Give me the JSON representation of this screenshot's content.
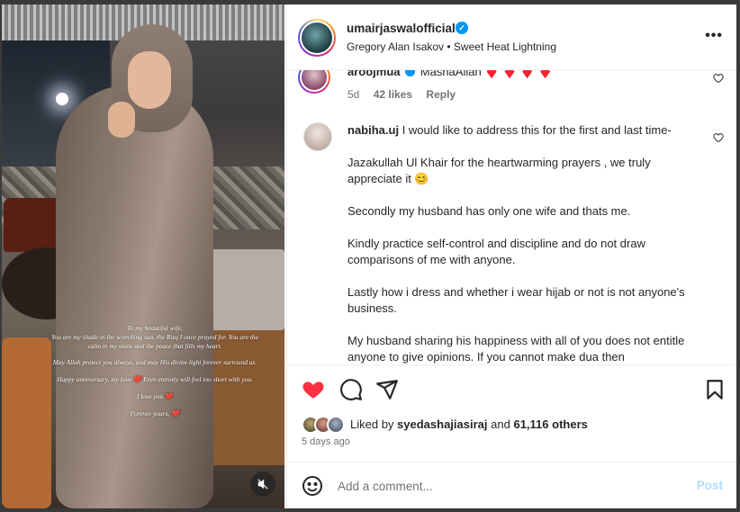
{
  "post": {
    "username": "umairjaswalofficial",
    "verified": true,
    "audio": "Gregory Alan Isakov • Sweet Heat Lightning",
    "date": "5 days ago"
  },
  "media": {
    "overlay_lines": [
      "To my beautiful wife,",
      "You are my shade in the scorching sun, the Rizq I once prayed for. You are the calm in my smile and the peace that fills my heart.",
      "May Allah protect you always, and may His divine light forever surround us.",
      "Happy anniversary, my love ❤️ Even eternity will feel too short with you.",
      "I love you ❤️",
      "Forever yours, ❤️"
    ]
  },
  "comments": [
    {
      "username": "aroojmua",
      "text": "MashaAllah ♦️ ♦️ ♦️ ♦️",
      "age": "5d",
      "likes": "42 likes",
      "reply": "Reply"
    },
    {
      "username": "nabiha.uj",
      "text": "I would like to address this for the first and last time-\n\nJazakullah Ul Khair for the heartwarming prayers , we truly appreciate it 😊\n\nSecondly my husband has only one wife and thats me.\n\nKindly practice self-control and discipline and do not draw comparisons of me with anyone.\n\nLastly how i dress and whether i wear hijab or not is not anyone's business.\n\nMy husband sharing his happiness with all of you does not entitle anyone to give opinions. If you cannot make dua then"
    }
  ],
  "likes": {
    "prefix": "Liked by",
    "user": "syedashajiasiraj",
    "and": "and",
    "count": "61,116 others"
  },
  "composer": {
    "placeholder": "Add a comment...",
    "post_label": "Post"
  },
  "colors": {
    "like_red": "#ff3040",
    "verified_blue": "#0095f6",
    "post_disabled": "#b3dbff"
  },
  "icons": [
    "heart-icon",
    "comment-icon",
    "share-icon",
    "bookmark-icon",
    "emoji-icon",
    "mute-icon",
    "more-icon",
    "verified-badge-icon"
  ]
}
